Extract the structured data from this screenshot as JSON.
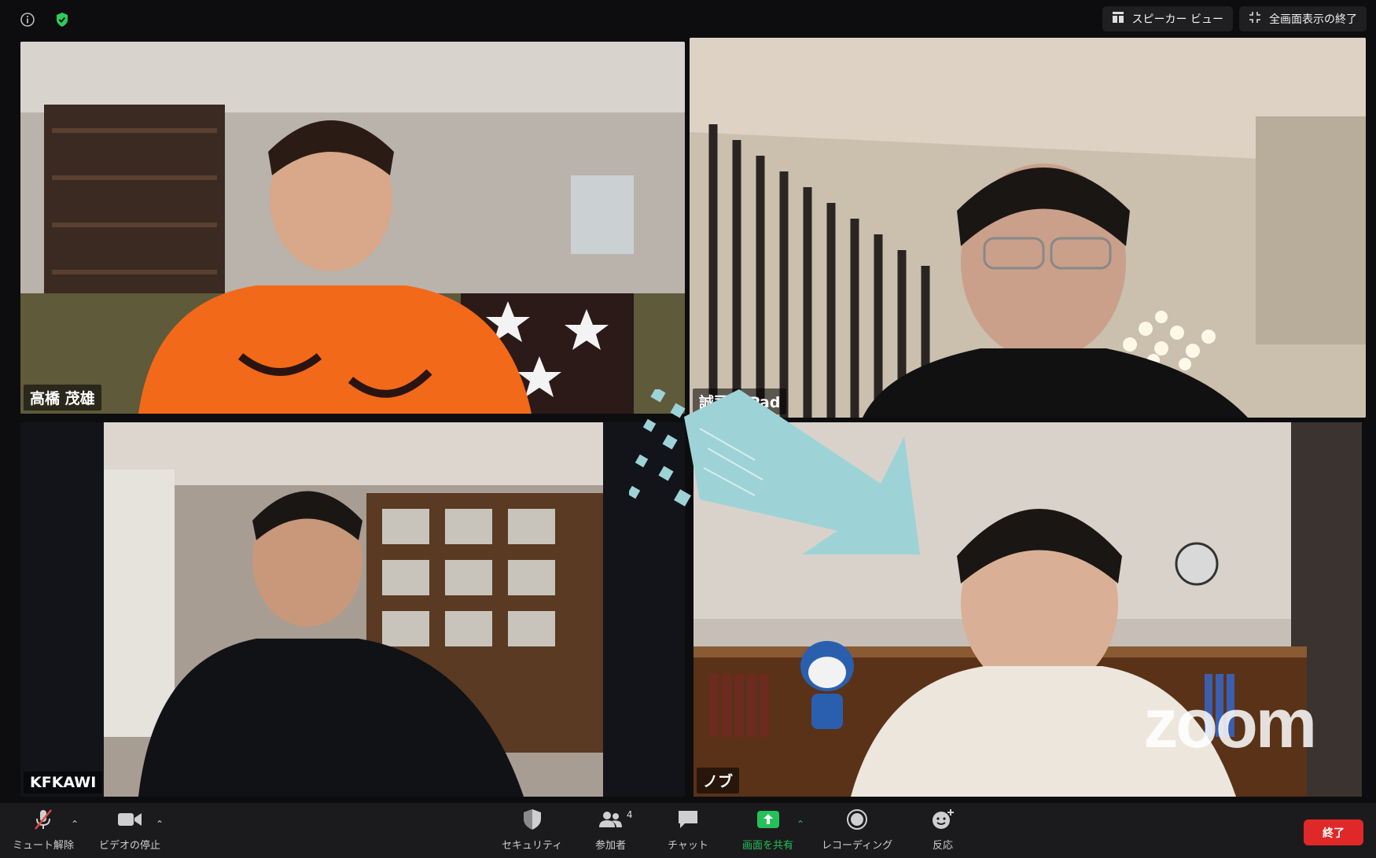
{
  "topbar": {
    "speaker_view_label": "スピーカー ビュー",
    "exit_fullscreen_label": "全画面表示の終了"
  },
  "participants": [
    {
      "name": "高橋 茂雄"
    },
    {
      "name": "誠司のiPad"
    },
    {
      "name": "KFKAWI"
    },
    {
      "name": "ノブ"
    }
  ],
  "watermark": "zoom",
  "toolbar": {
    "mute_label": "ミュート解除",
    "video_label": "ビデオの停止",
    "security_label": "セキュリティ",
    "participants_label": "参加者",
    "participants_count": "4",
    "chat_label": "チャット",
    "share_label": "画面を共有",
    "record_label": "レコーディング",
    "reactions_label": "反応",
    "end_label": "終了"
  },
  "colors": {
    "active_speaker": "#7ee25a",
    "share_green": "#25c05a",
    "end_red": "#e02828",
    "arrow_teal": "#9dd3d6"
  }
}
